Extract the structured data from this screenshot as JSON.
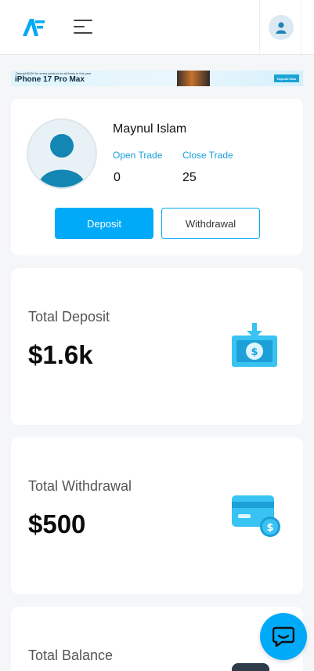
{
  "header": {
    "logo_icon": "af-logo-icon",
    "menu_icon": "hamburger-menu-icon",
    "user_icon": "user-avatar-icon",
    "brand_color": "#00aaf8"
  },
  "banner": {
    "small_text": "Deposit $100 for every product on all items in this year",
    "title": "iPhone 17 Pro Max",
    "button_label": "Deposit Now"
  },
  "profile": {
    "name": "Maynul Islam",
    "open_trade_label": "Open Trade",
    "close_trade_label": "Close Trade",
    "open_trade_value": "0",
    "close_trade_value": "25",
    "deposit_label": "Deposit",
    "withdrawal_label": "Withdrawal"
  },
  "stats": {
    "deposit": {
      "label": "Total Deposit",
      "value": "$1.6k",
      "icon": "money-deposit-icon"
    },
    "withdrawal": {
      "label": "Total Withdrawal",
      "value": "$500",
      "icon": "card-withdrawal-icon"
    },
    "balance": {
      "label": "Total Balance",
      "icon": "wallet-icon"
    }
  },
  "chat": {
    "icon": "chat-bubble-icon"
  }
}
